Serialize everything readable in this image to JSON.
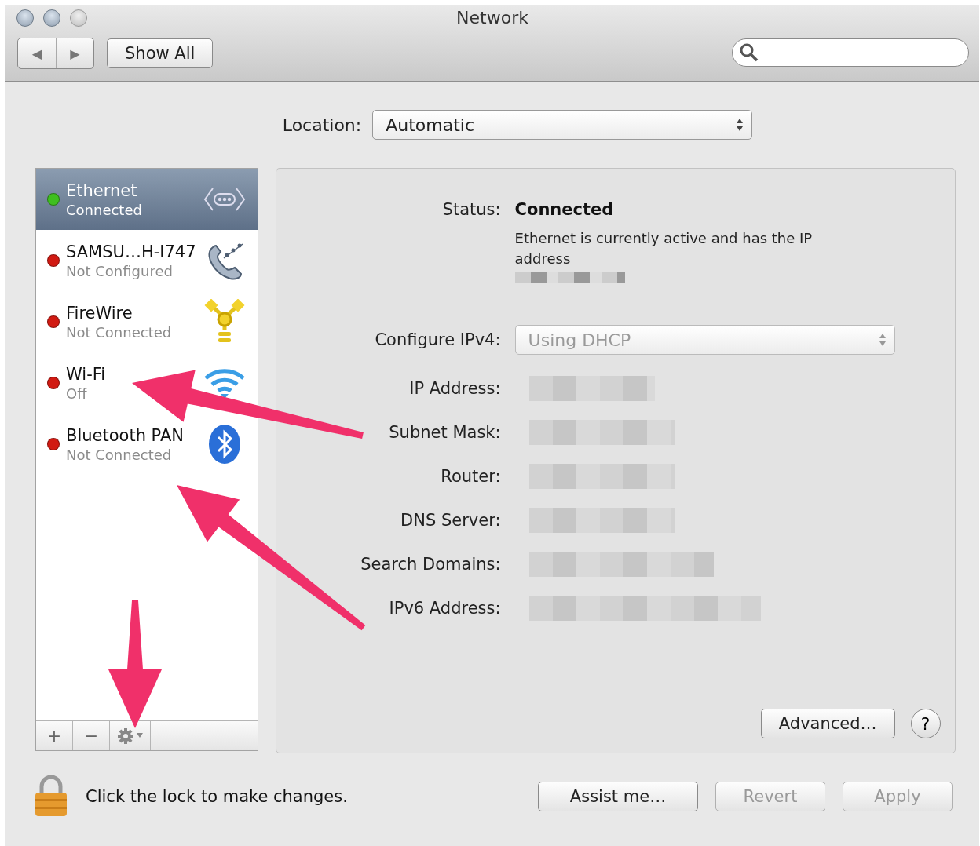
{
  "window": {
    "title": "Network"
  },
  "toolbar": {
    "back": "◀",
    "forward": "▶",
    "show_all": "Show All"
  },
  "location": {
    "label": "Location:",
    "value": "Automatic"
  },
  "services": [
    {
      "name": "Ethernet",
      "status": "Connected",
      "selected": true,
      "kind": "ethernet",
      "color": "#3fbf1f"
    },
    {
      "name": "SAMSU…H-I747",
      "status": "Not Configured",
      "selected": false,
      "kind": "phone",
      "color": "#d11a12"
    },
    {
      "name": "FireWire",
      "status": "Not Connected",
      "selected": false,
      "kind": "firewire",
      "color": "#d11a12"
    },
    {
      "name": "Wi-Fi",
      "status": "Off",
      "selected": false,
      "kind": "wifi",
      "color": "#d11a12"
    },
    {
      "name": "Bluetooth PAN",
      "status": "Not Connected",
      "selected": false,
      "kind": "bluetooth",
      "color": "#d11a12"
    }
  ],
  "list_buttons": {
    "add": "+",
    "remove": "−"
  },
  "status": {
    "label": "Status:",
    "value": "Connected",
    "description": "Ethernet is currently active and has the IP address"
  },
  "configure_ipv4": {
    "label": "Configure IPv4:",
    "value": "Using DHCP",
    "disabled": true
  },
  "fields": [
    {
      "label": "IP Address:"
    },
    {
      "label": "Subnet Mask:"
    },
    {
      "label": "Router:"
    },
    {
      "label": "DNS Server:"
    },
    {
      "label": "Search Domains:"
    },
    {
      "label": "IPv6 Address:"
    }
  ],
  "advanced": "Advanced…",
  "help": "?",
  "lock_text": "Click the lock to make changes.",
  "footer_buttons": [
    {
      "label": "Assist me…",
      "disabled": false
    },
    {
      "label": "Revert",
      "disabled": true
    },
    {
      "label": "Apply",
      "disabled": true
    }
  ]
}
